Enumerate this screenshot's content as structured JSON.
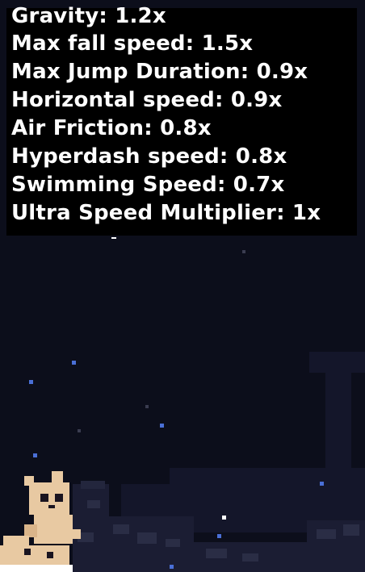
{
  "stats": [
    {
      "label": "Gravity",
      "value": "1.2x",
      "text": "Gravity: 1.2x"
    },
    {
      "label": "Max fall speed",
      "value": "1.5x",
      "text": "Max fall speed: 1.5x"
    },
    {
      "label": "Max Jump Duration",
      "value": "0.9x",
      "text": "Max Jump Duration: 0.9x"
    },
    {
      "label": "Horizontal speed",
      "value": "0.9x",
      "text": "Horizontal speed: 0.9x"
    },
    {
      "label": "Air Friction",
      "value": "0.8x",
      "text": "Air Friction: 0.8x"
    },
    {
      "label": "Hyperdash speed",
      "value": "0.8x",
      "text": "Hyperdash speed: 0.8x"
    },
    {
      "label": "Swimming Speed",
      "value": "0.7x",
      "text": "Swimming Speed: 0.7x"
    },
    {
      "label": "Ultra Speed Multiplier",
      "value": "1x",
      "text": "Ultra Speed Multiplier: 1x"
    }
  ],
  "colors": {
    "background": "#0c0e1b",
    "overlay": "#000000",
    "text": "#ffffff",
    "terrain_dark": "#1b1d33",
    "terrain_mid": "#2a2d45",
    "particle_blue": "#4a6fd6",
    "particle_white": "#ffffff",
    "character_fur": "#e8c9a2"
  },
  "icons": [
    "cat-character-icon",
    "snow-particle-icon"
  ]
}
